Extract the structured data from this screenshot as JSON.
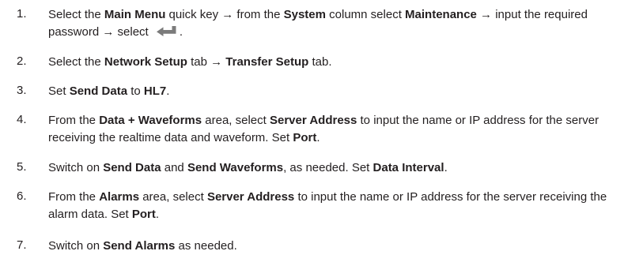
{
  "steps": [
    {
      "number": "1.",
      "parts": [
        {
          "t": "Select the "
        },
        {
          "b": "Main Menu"
        },
        {
          "t": " quick key → from the "
        },
        {
          "b": "System"
        },
        {
          "t": " column select "
        },
        {
          "b": "Maintenance"
        },
        {
          "t": " → input the required password → select "
        },
        {
          "icon": "enter-key-icon"
        },
        {
          "t": "."
        }
      ]
    },
    {
      "number": "2.",
      "parts": [
        {
          "t": "Select the "
        },
        {
          "b": "Network Setup"
        },
        {
          "t": " tab → "
        },
        {
          "b": "Transfer Setup"
        },
        {
          "t": " tab."
        }
      ]
    },
    {
      "number": "3.",
      "parts": [
        {
          "t": "Set "
        },
        {
          "b": "Send Data"
        },
        {
          "t": " to "
        },
        {
          "b": "HL7"
        },
        {
          "t": "."
        }
      ]
    },
    {
      "number": "4.",
      "parts": [
        {
          "t": "From the "
        },
        {
          "b": "Data + Waveforms"
        },
        {
          "t": " area, select "
        },
        {
          "b": "Server Address"
        },
        {
          "t": " to input the name or IP address for the server receiving the realtime data and waveform. Set "
        },
        {
          "b": "Port"
        },
        {
          "t": "."
        }
      ]
    },
    {
      "number": "5.",
      "parts": [
        {
          "t": "Switch on "
        },
        {
          "b": "Send Data"
        },
        {
          "t": " and "
        },
        {
          "b": "Send Waveforms"
        },
        {
          "t": ", as needed. Set "
        },
        {
          "b": "Data Interval"
        },
        {
          "t": "."
        }
      ]
    },
    {
      "number": "6.",
      "parts": [
        {
          "t": "From the "
        },
        {
          "b": "Alarms"
        },
        {
          "t": " area, select "
        },
        {
          "b": "Server Address"
        },
        {
          "t": " to input the name or IP address for the server receiving the alarm data. Set "
        },
        {
          "b": "Port"
        },
        {
          "t": "."
        }
      ]
    },
    {
      "number": "7.",
      "parts": [
        {
          "t": "Switch on "
        },
        {
          "b": "Send Alarms"
        },
        {
          "t": " as needed."
        }
      ]
    }
  ],
  "icon_color": "#7b7b7b"
}
